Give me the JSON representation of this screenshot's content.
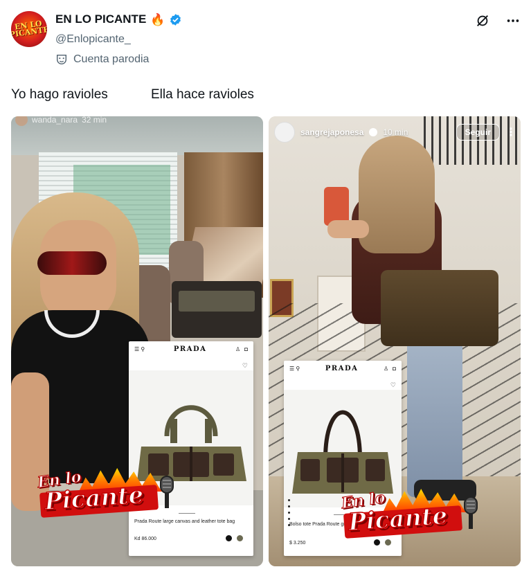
{
  "account": {
    "display_name": "EN LO PICANTE",
    "handle": "@Enlopicante_",
    "parody_label": "Cuenta parodia",
    "avatar_text": "EN LO PICANTE"
  },
  "colors": {
    "verified": "#1d9bf0",
    "text_secondary": "#536471",
    "logo_red": "#d10e0e"
  },
  "tweet": {
    "caption_left": "Yo hago ravioles",
    "caption_right": "Ella hace ravioles"
  },
  "left_story": {
    "username": "wanda_nara",
    "time": "32 min",
    "product": {
      "brand": "PRADA",
      "title": "Prada Route large canvas and leather tote bag",
      "price": "Kd 86.000",
      "swatches": [
        "#111111",
        "#6b6a52"
      ]
    },
    "logo": {
      "line1": "En lo",
      "line2": "Picante"
    }
  },
  "right_story": {
    "username": "sangrejaponesa",
    "time": "10 min",
    "follow_label": "Seguir",
    "product": {
      "brand": "PRADA",
      "title": "Bolso tote Prada Route grande de lona y piel",
      "price": "$ 3.250",
      "swatches": [
        "#111111",
        "#6b6a52"
      ]
    },
    "logo": {
      "line1": "En lo",
      "line2": "Picante"
    }
  }
}
